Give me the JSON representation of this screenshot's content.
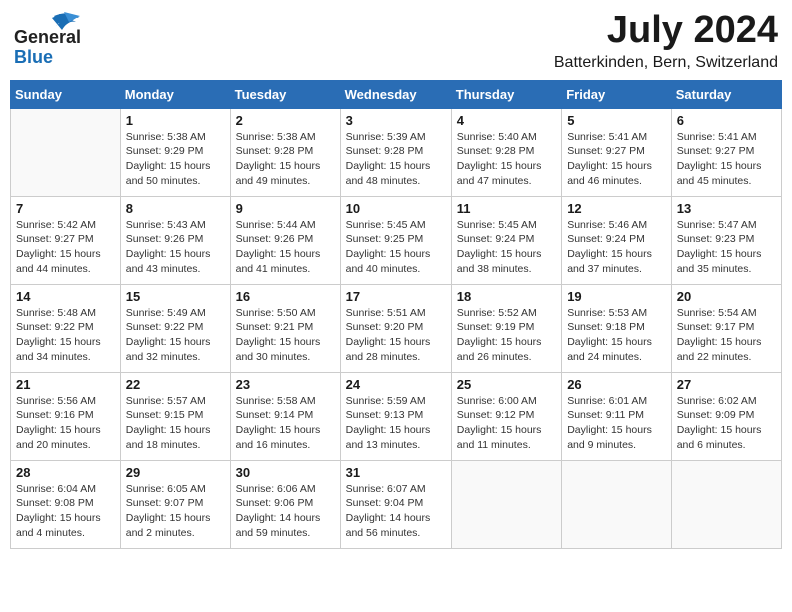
{
  "header": {
    "logo_general": "General",
    "logo_blue": "Blue",
    "month_year": "July 2024",
    "location": "Batterkinden, Bern, Switzerland"
  },
  "days_of_week": [
    "Sunday",
    "Monday",
    "Tuesday",
    "Wednesday",
    "Thursday",
    "Friday",
    "Saturday"
  ],
  "weeks": [
    [
      {
        "day": "",
        "info": ""
      },
      {
        "day": "1",
        "info": "Sunrise: 5:38 AM\nSunset: 9:29 PM\nDaylight: 15 hours\nand 50 minutes."
      },
      {
        "day": "2",
        "info": "Sunrise: 5:38 AM\nSunset: 9:28 PM\nDaylight: 15 hours\nand 49 minutes."
      },
      {
        "day": "3",
        "info": "Sunrise: 5:39 AM\nSunset: 9:28 PM\nDaylight: 15 hours\nand 48 minutes."
      },
      {
        "day": "4",
        "info": "Sunrise: 5:40 AM\nSunset: 9:28 PM\nDaylight: 15 hours\nand 47 minutes."
      },
      {
        "day": "5",
        "info": "Sunrise: 5:41 AM\nSunset: 9:27 PM\nDaylight: 15 hours\nand 46 minutes."
      },
      {
        "day": "6",
        "info": "Sunrise: 5:41 AM\nSunset: 9:27 PM\nDaylight: 15 hours\nand 45 minutes."
      }
    ],
    [
      {
        "day": "7",
        "info": "Sunrise: 5:42 AM\nSunset: 9:27 PM\nDaylight: 15 hours\nand 44 minutes."
      },
      {
        "day": "8",
        "info": "Sunrise: 5:43 AM\nSunset: 9:26 PM\nDaylight: 15 hours\nand 43 minutes."
      },
      {
        "day": "9",
        "info": "Sunrise: 5:44 AM\nSunset: 9:26 PM\nDaylight: 15 hours\nand 41 minutes."
      },
      {
        "day": "10",
        "info": "Sunrise: 5:45 AM\nSunset: 9:25 PM\nDaylight: 15 hours\nand 40 minutes."
      },
      {
        "day": "11",
        "info": "Sunrise: 5:45 AM\nSunset: 9:24 PM\nDaylight: 15 hours\nand 38 minutes."
      },
      {
        "day": "12",
        "info": "Sunrise: 5:46 AM\nSunset: 9:24 PM\nDaylight: 15 hours\nand 37 minutes."
      },
      {
        "day": "13",
        "info": "Sunrise: 5:47 AM\nSunset: 9:23 PM\nDaylight: 15 hours\nand 35 minutes."
      }
    ],
    [
      {
        "day": "14",
        "info": "Sunrise: 5:48 AM\nSunset: 9:22 PM\nDaylight: 15 hours\nand 34 minutes."
      },
      {
        "day": "15",
        "info": "Sunrise: 5:49 AM\nSunset: 9:22 PM\nDaylight: 15 hours\nand 32 minutes."
      },
      {
        "day": "16",
        "info": "Sunrise: 5:50 AM\nSunset: 9:21 PM\nDaylight: 15 hours\nand 30 minutes."
      },
      {
        "day": "17",
        "info": "Sunrise: 5:51 AM\nSunset: 9:20 PM\nDaylight: 15 hours\nand 28 minutes."
      },
      {
        "day": "18",
        "info": "Sunrise: 5:52 AM\nSunset: 9:19 PM\nDaylight: 15 hours\nand 26 minutes."
      },
      {
        "day": "19",
        "info": "Sunrise: 5:53 AM\nSunset: 9:18 PM\nDaylight: 15 hours\nand 24 minutes."
      },
      {
        "day": "20",
        "info": "Sunrise: 5:54 AM\nSunset: 9:17 PM\nDaylight: 15 hours\nand 22 minutes."
      }
    ],
    [
      {
        "day": "21",
        "info": "Sunrise: 5:56 AM\nSunset: 9:16 PM\nDaylight: 15 hours\nand 20 minutes."
      },
      {
        "day": "22",
        "info": "Sunrise: 5:57 AM\nSunset: 9:15 PM\nDaylight: 15 hours\nand 18 minutes."
      },
      {
        "day": "23",
        "info": "Sunrise: 5:58 AM\nSunset: 9:14 PM\nDaylight: 15 hours\nand 16 minutes."
      },
      {
        "day": "24",
        "info": "Sunrise: 5:59 AM\nSunset: 9:13 PM\nDaylight: 15 hours\nand 13 minutes."
      },
      {
        "day": "25",
        "info": "Sunrise: 6:00 AM\nSunset: 9:12 PM\nDaylight: 15 hours\nand 11 minutes."
      },
      {
        "day": "26",
        "info": "Sunrise: 6:01 AM\nSunset: 9:11 PM\nDaylight: 15 hours\nand 9 minutes."
      },
      {
        "day": "27",
        "info": "Sunrise: 6:02 AM\nSunset: 9:09 PM\nDaylight: 15 hours\nand 6 minutes."
      }
    ],
    [
      {
        "day": "28",
        "info": "Sunrise: 6:04 AM\nSunset: 9:08 PM\nDaylight: 15 hours\nand 4 minutes."
      },
      {
        "day": "29",
        "info": "Sunrise: 6:05 AM\nSunset: 9:07 PM\nDaylight: 15 hours\nand 2 minutes."
      },
      {
        "day": "30",
        "info": "Sunrise: 6:06 AM\nSunset: 9:06 PM\nDaylight: 14 hours\nand 59 minutes."
      },
      {
        "day": "31",
        "info": "Sunrise: 6:07 AM\nSunset: 9:04 PM\nDaylight: 14 hours\nand 56 minutes."
      },
      {
        "day": "",
        "info": ""
      },
      {
        "day": "",
        "info": ""
      },
      {
        "day": "",
        "info": ""
      }
    ]
  ]
}
